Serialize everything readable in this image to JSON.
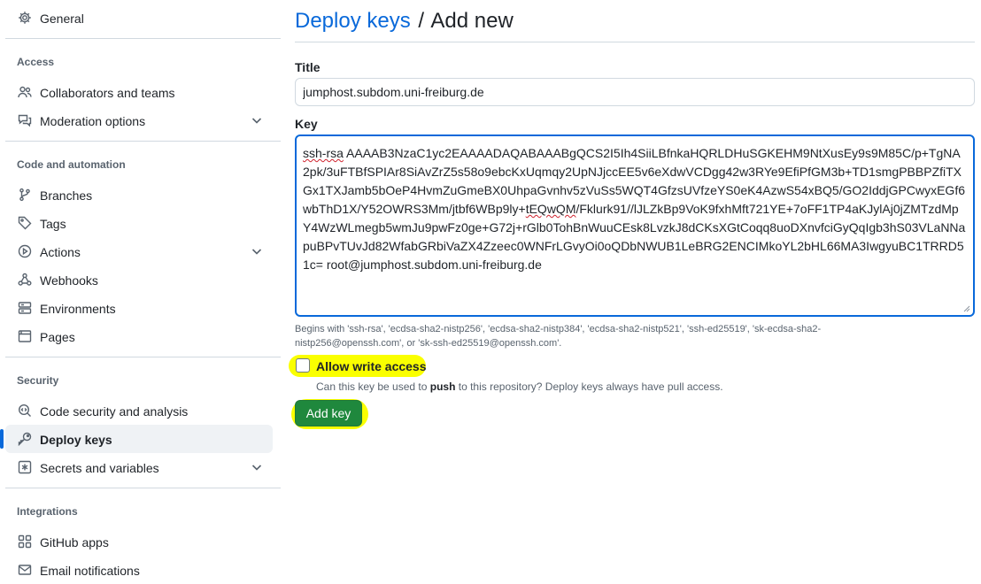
{
  "sidebar": {
    "general": "General",
    "sections": {
      "access": "Access",
      "code": "Code and automation",
      "security": "Security",
      "integrations": "Integrations"
    },
    "items": {
      "collaborators": "Collaborators and teams",
      "moderation": "Moderation options",
      "branches": "Branches",
      "tags": "Tags",
      "actions": "Actions",
      "webhooks": "Webhooks",
      "environments": "Environments",
      "pages": "Pages",
      "code_security": "Code security and analysis",
      "deploy_keys": "Deploy keys",
      "secrets": "Secrets and variables",
      "github_apps": "GitHub apps",
      "email": "Email notifications"
    }
  },
  "header": {
    "breadcrumb": "Deploy keys",
    "separator": "/",
    "current": "Add new"
  },
  "form": {
    "title_label": "Title",
    "title_value": "jumphost.subdom.uni-freiburg.de",
    "key_label": "Key",
    "key_prefix": "ssh-rsa",
    "key_part1": " AAAAB3NzaC1yc2EAAAADAQABAAABgQCS2I5Ih4SiiLBfnkaHQRLDHuSGKEHM9NtXusEy9s9M85C/p+TgNA2pk/3uFTBfSPIAr8SiAvZrZ5s58o9ebcKxUqmqy2UpNJjccEE5v6eXdwVCDgg42w3RYe9EfiPfGM3b+TD1smgPBBPZfiTXGx1TXJamb5bOeP4HvmZuGmeBX0UhpaGvnhv5zVuSs5WQT4GfzsUVfzeYS0eK4AzwS54xBQ5/GO2IddjGPCwyxEGf6wbThD1X/Y52OWRS3Mm/jtbf6WBp9ly+",
    "key_mid": "tEQwQM",
    "key_part2": "/Fklurk91//lJLZkBp9VoK9fxhMft721YE+7oFF1TP4aKJylAj0jZMTzdMpY4WzWLmegb5wmJu9pwFz0ge+G72j+rGlb0TohBnWuuCEsk8LvzkJ8dCKsXGtCoqq8uoDXnvfciGyQqIgb3hS03VLaNNapuBPvTUvJd82WfabGRbiVaZX4Zzeec0WNFrLGvyOi0oQDbNWUB1LeBRG2ENCIMkoYL2bHL66MA3IwgyuBC1TRRD51c= root@jumphost.subdom.uni-freiburg.de",
    "hint": "Begins with 'ssh-rsa', 'ecdsa-sha2-nistp256', 'ecdsa-sha2-nistp384', 'ecdsa-sha2-nistp521', 'ssh-ed25519', 'sk-ecdsa-sha2-nistp256@openssh.com', or 'sk-ssh-ed25519@openssh.com'.",
    "write_access_label": "Allow write access",
    "write_access_note_pre": "Can this key be used to ",
    "write_access_note_bold": "push",
    "write_access_note_post": " to this repository? Deploy keys always have pull access.",
    "submit_label": "Add key"
  },
  "colors": {
    "accent": "#0969da",
    "button_green": "#1f883d",
    "highlight": "#faff00"
  }
}
